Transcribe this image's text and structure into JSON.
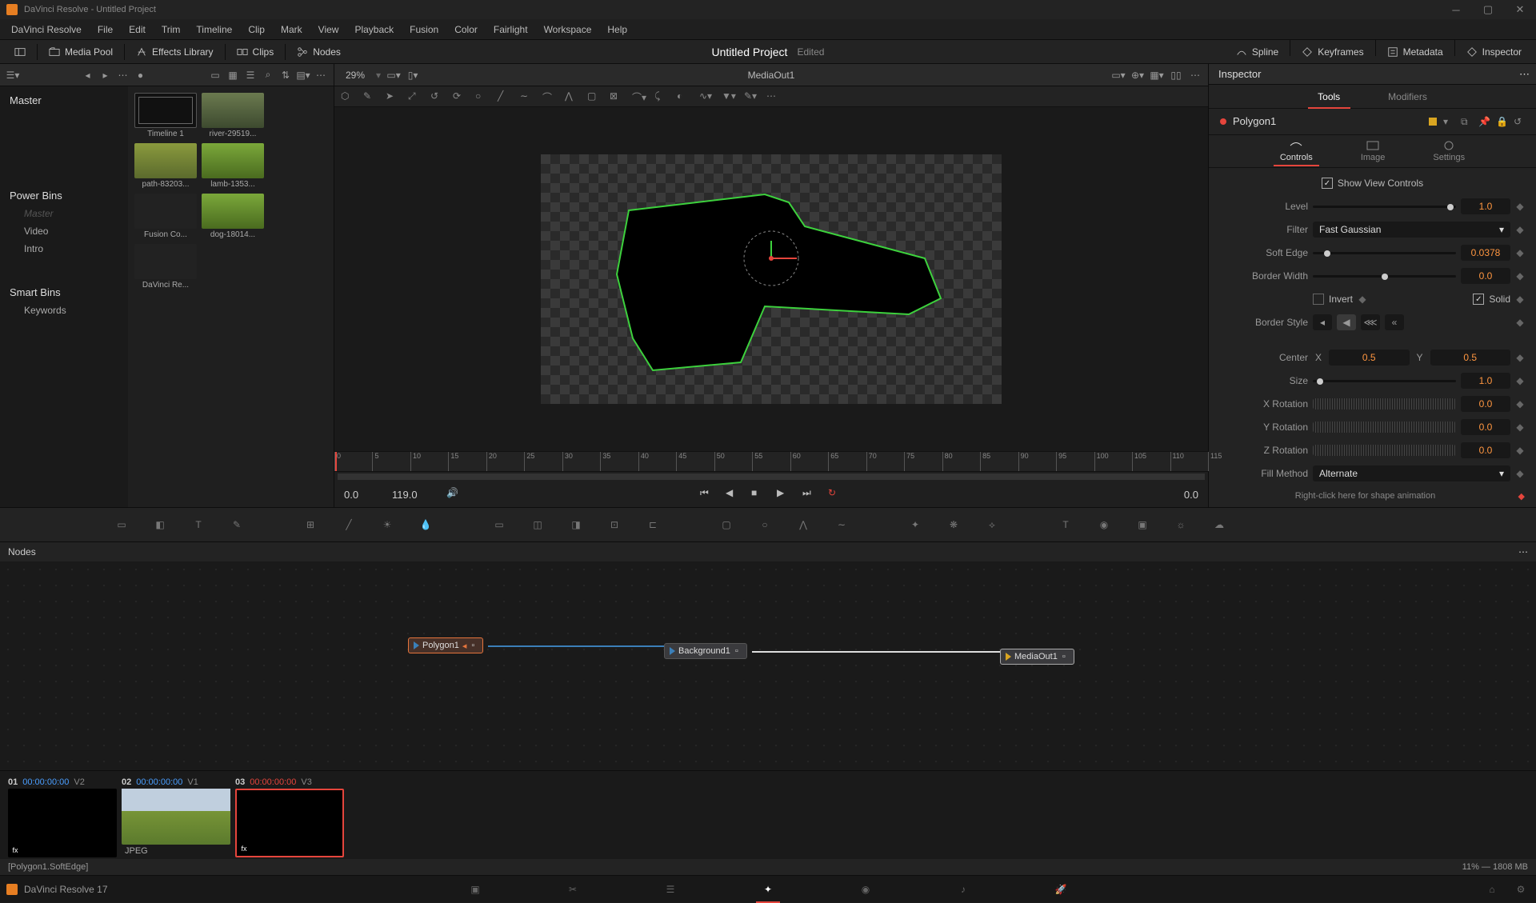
{
  "titlebar": {
    "app": "DaVinci Resolve",
    "project": "Untitled Project"
  },
  "menubar": [
    "DaVinci Resolve",
    "File",
    "Edit",
    "Trim",
    "Timeline",
    "Clip",
    "Mark",
    "View",
    "Playback",
    "Fusion",
    "Color",
    "Fairlight",
    "Workspace",
    "Help"
  ],
  "toolbar": {
    "media_pool": "Media Pool",
    "effects": "Effects Library",
    "clips": "Clips",
    "nodes": "Nodes",
    "project_name": "Untitled Project",
    "project_status": "Edited",
    "spline": "Spline",
    "keyframes": "Keyframes",
    "metadata": "Metadata",
    "inspector": "Inspector"
  },
  "zoom": "29%",
  "viewer_title": "MediaOut1",
  "bins": {
    "master": "Master",
    "power": "Power Bins",
    "power_master": "Master",
    "video": "Video",
    "intro": "Intro",
    "smart": "Smart Bins",
    "keywords": "Keywords"
  },
  "thumbs": [
    {
      "label": "Timeline 1",
      "cls": "timeline"
    },
    {
      "label": "river-29519...",
      "cls": "river"
    },
    {
      "label": "path-83203...",
      "cls": "path"
    },
    {
      "label": "lamb-1353...",
      "cls": "green"
    },
    {
      "label": "Fusion Co...",
      "cls": "dark"
    },
    {
      "label": "dog-18014...",
      "cls": "green"
    },
    {
      "label": "DaVinci Re...",
      "cls": "dark"
    }
  ],
  "ruler": [
    "0",
    "5",
    "10",
    "15",
    "20",
    "25",
    "30",
    "35",
    "40",
    "45",
    "50",
    "55",
    "60",
    "65",
    "70",
    "75",
    "80",
    "85",
    "90",
    "95",
    "100",
    "105",
    "110",
    "115"
  ],
  "playback": {
    "current": "0.0",
    "duration": "119.0",
    "end": "0.0"
  },
  "nodes_panel": {
    "title": "Nodes",
    "poly": "Polygon1",
    "bg": "Background1",
    "out": "MediaOut1"
  },
  "clips": [
    {
      "num": "01",
      "tc": "00:00:00:00",
      "track": "V2",
      "cls": "",
      "active": false
    },
    {
      "num": "02",
      "tc": "00:00:00:00",
      "track": "V1",
      "cls": "field",
      "active": false,
      "type": "JPEG"
    },
    {
      "num": "03",
      "tc": "00:00:00:00",
      "track": "V3",
      "cls": "",
      "active": true
    }
  ],
  "inspector_panel": {
    "title": "Inspector",
    "tabs": {
      "tools": "Tools",
      "modifiers": "Modifiers"
    },
    "node": "Polygon1",
    "subtabs": {
      "controls": "Controls",
      "image": "Image",
      "settings": "Settings"
    },
    "show_view": "Show View Controls",
    "level": {
      "label": "Level",
      "value": "1.0"
    },
    "filter": {
      "label": "Filter",
      "value": "Fast Gaussian"
    },
    "soft_edge": {
      "label": "Soft Edge",
      "value": "0.0378"
    },
    "border_width": {
      "label": "Border Width",
      "value": "0.0"
    },
    "invert": "Invert",
    "solid": "Solid",
    "border_style": "Border Style",
    "center": {
      "label": "Center",
      "x": "X",
      "xv": "0.5",
      "y": "Y",
      "yv": "0.5"
    },
    "size": {
      "label": "Size",
      "value": "1.0"
    },
    "xrot": {
      "label": "X Rotation",
      "value": "0.0"
    },
    "yrot": {
      "label": "Y Rotation",
      "value": "0.0"
    },
    "zrot": {
      "label": "Z Rotation",
      "value": "0.0"
    },
    "fill": {
      "label": "Fill Method",
      "value": "Alternate"
    },
    "shape_anim": "Right-click here for shape animation"
  },
  "status": {
    "left": "[Polygon1.SoftEdge]",
    "right": "11% — 1808 MB"
  },
  "footer": {
    "app": "DaVinci Resolve 17"
  }
}
